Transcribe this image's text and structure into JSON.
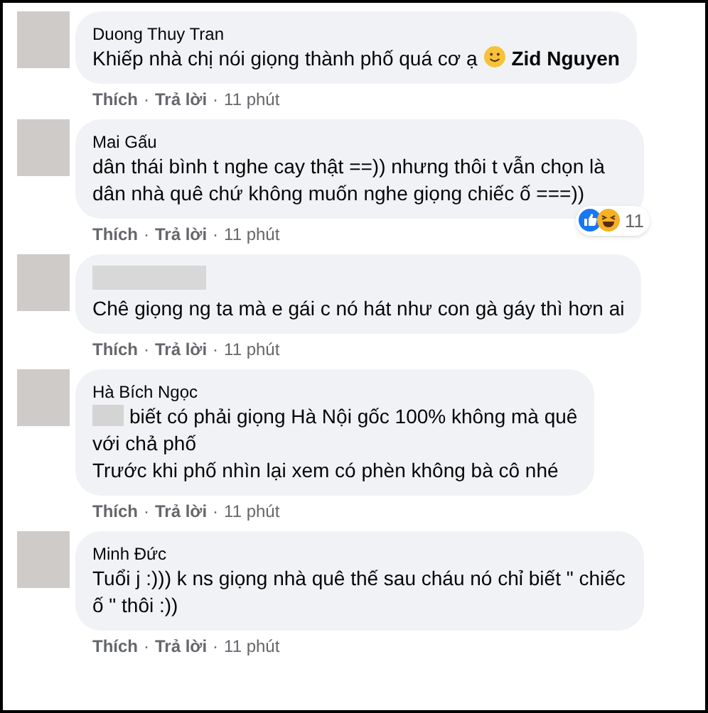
{
  "comments": [
    {
      "author": "Duong Thuy Tran",
      "parts": [
        {
          "kind": "text",
          "text": "Khiếp nhà chị nói giọng thành phố quá cơ ạ"
        },
        {
          "kind": "emoji"
        },
        {
          "kind": "mention",
          "text": "Zid Nguyen"
        }
      ],
      "actions": [
        "Thích",
        "·",
        "Trả lời",
        "·",
        "11 phút"
      ]
    },
    {
      "author": "Mai Gấu",
      "parts": [
        {
          "kind": "text",
          "text": "dân thái bình t nghe cay thật ==)) nhưng thôi t vẫn chọn là dân nhà quê chứ không muốn nghe giọng chiếc ố ===))"
        }
      ],
      "reactions": {
        "count": "11"
      },
      "actions": [
        "Thích",
        "·",
        "Trả lời",
        "·",
        "11 phút"
      ]
    },
    {
      "author_hidden": true,
      "parts": [
        {
          "kind": "text",
          "text": "Chê giọng ng ta mà e gái c nó hát như con gà gáy thì hơn ai"
        }
      ],
      "actions": [
        "Thích",
        "·",
        "Trả lời",
        "·",
        "11 phút"
      ]
    },
    {
      "author": "Hà Bích Ngọc",
      "parts": [
        {
          "kind": "blur"
        },
        {
          "kind": "text",
          "text": "biết có phải giọng Hà Nội gốc 100% không mà quê"
        },
        {
          "kind": "line",
          "text": "với chả phố"
        },
        {
          "kind": "line",
          "text": "Trước khi phố nhìn lại xem có phèn không bà cô nhé"
        }
      ],
      "actions": [
        "Thích",
        "·",
        "Trả lời",
        "·",
        "11 phút"
      ]
    },
    {
      "author": "Minh Đức",
      "parts": [
        {
          "kind": "text",
          "text": "Tuổi j :))) k ns giọng nhà quê thế sau cháu nó chỉ biết \" chiếc ố \" thôi :))"
        }
      ],
      "actions": [
        "Thích",
        "·",
        "Trả lời",
        "·",
        "11 phút"
      ]
    }
  ]
}
